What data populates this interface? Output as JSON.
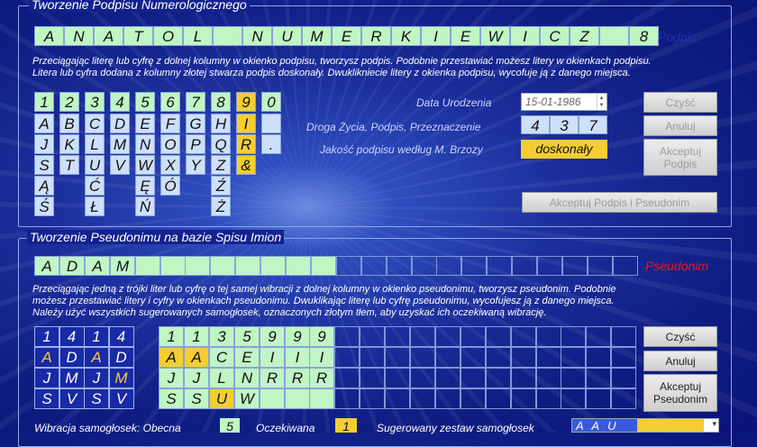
{
  "signature_section": {
    "title": "Tworzenie Podpisu Numerologicznego",
    "name_letters": [
      "A",
      "N",
      "A",
      "T",
      "O",
      "L",
      "",
      "N",
      "U",
      "M",
      "E",
      "R",
      "K",
      "I",
      "E",
      "W",
      "I",
      "C",
      "Z",
      "",
      "8"
    ],
    "side_label": "Podpis",
    "instructions": [
      "Przeciągając literę lub cyfrę z dolnej kolumny w okienko podpisu, tworzysz podpis. Podobnie przestawiać możesz litery w okienkach podpisu.",
      "Litera lub cyfra dodana z kolumny złotej stwarza podpis doskonały. Dwuklikniecie litery z okienka podpisu, wycofuje ją z danego miejsca."
    ],
    "digits": [
      "1",
      "2",
      "3",
      "4",
      "5",
      "6",
      "7",
      "8",
      "9",
      "0"
    ],
    "letter_columns": [
      [
        "A",
        "J",
        "S",
        "Ą",
        "Ś"
      ],
      [
        "B",
        "K",
        "T"
      ],
      [
        "C",
        "L",
        "U",
        "Ć",
        "Ł"
      ],
      [
        "D",
        "M",
        "V"
      ],
      [
        "E",
        "N",
        "W",
        "Ę",
        "Ń"
      ],
      [
        "F",
        "O",
        "X",
        "Ó"
      ],
      [
        "G",
        "P",
        "Y"
      ],
      [
        "H",
        "Q",
        "Z",
        "Ź",
        "Ż"
      ],
      [
        "I",
        "R",
        "&"
      ],
      [
        "",
        "."
      ]
    ],
    "birth_date_label": "Data Urodzenia",
    "birth_date": "15-01-1986",
    "life_path_label": "Droga Życia, Podpis, Przeznaczenie",
    "life_path_values": [
      "4",
      "3",
      "7"
    ],
    "quality_label": "Jakość podpisu według M. Brzozy",
    "quality_value": "doskonały",
    "buttons": {
      "clear": "Czyść",
      "cancel": "Anuluj",
      "accept_line1": "Akceptuj",
      "accept_line2": "Podpis",
      "accept_both": "Akceptuj Podpis i Pseudonim"
    }
  },
  "pseudonym_section": {
    "title": "Tworzenie Pseudonimu na bazie Spisu Imion",
    "letters": [
      "A",
      "D",
      "A",
      "M"
    ],
    "side_label": "Pseudonim",
    "instructions": [
      "Przeciągając jedną z trójki liter lub cyfrę o tej samej wibracji z dolnej kolumny w okienko pseudonimu, tworzysz pseudonim. Podobnie",
      "możesz przestawiać litery i cyfry w okienkach pseudonimu. Dwuklikając literę lub cyfrę pseudonimu, wycofujesz ją z danego miejsca.",
      "Należy użyć wszystkich sugerowanych samogłosek, oznaczonych złotym tłem, aby uzyskać ich oczekiwaną wibrację."
    ],
    "used_columns": [
      [
        "1",
        "A",
        "J",
        "S"
      ],
      [
        "4",
        "D",
        "M",
        "V"
      ],
      [
        "1",
        "A",
        "J",
        "S"
      ],
      [
        "4",
        "D",
        "M",
        "V"
      ]
    ],
    "choice_columns": [
      [
        "1",
        "A",
        "J",
        "S"
      ],
      [
        "1",
        "A",
        "J",
        "S"
      ],
      [
        "3",
        "C",
        "L",
        "U"
      ],
      [
        "5",
        "E",
        "N",
        "W"
      ],
      [
        "9",
        "I",
        "R",
        ""
      ],
      [
        "9",
        "I",
        "R",
        ""
      ],
      [
        "9",
        "I",
        "R",
        ""
      ]
    ],
    "buttons": {
      "clear": "Czyść",
      "cancel": "Anuluj",
      "accept_line1": "Akceptuj",
      "accept_line2": "Pseudonim"
    },
    "vowel_vibration_label": "Wibracja samogłosek: Obecna",
    "vowel_current": "5",
    "vowel_expected_label": "Oczekiwana",
    "vowel_expected": "1",
    "suggested_label": "Sugerowany zestaw samogłosek",
    "suggested_value": "A A U"
  }
}
